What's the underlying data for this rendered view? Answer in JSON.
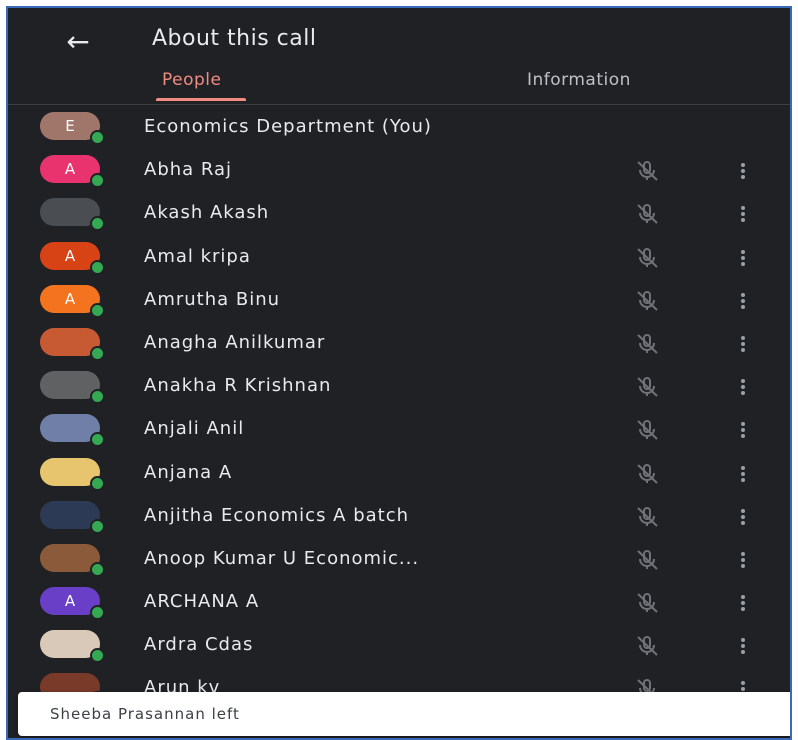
{
  "header": {
    "title": "About this call",
    "tabs": [
      {
        "label": "People",
        "active": true
      },
      {
        "label": "Information",
        "active": false
      }
    ]
  },
  "participants": [
    {
      "name": "Economics Department (You)",
      "avatar_letter": "E",
      "avatar_color": "#a1766a",
      "show_controls": false
    },
    {
      "name": "Abha Raj",
      "avatar_letter": "A",
      "avatar_color": "#e8336f",
      "show_controls": true
    },
    {
      "name": "Akash Akash",
      "avatar_letter": "",
      "avatar_color": "#4a4d52",
      "show_controls": true
    },
    {
      "name": "Amal kripa",
      "avatar_letter": "A",
      "avatar_color": "#d84315",
      "show_controls": true
    },
    {
      "name": "Amrutha Binu",
      "avatar_letter": "A",
      "avatar_color": "#f4731f",
      "show_controls": true
    },
    {
      "name": "Anagha Anilkumar",
      "avatar_letter": "",
      "avatar_color": "#c75a32",
      "show_controls": true
    },
    {
      "name": "Anakha R Krishnan",
      "avatar_letter": "",
      "avatar_color": "#5f6163",
      "show_controls": true
    },
    {
      "name": "Anjali Anil",
      "avatar_letter": "",
      "avatar_color": "#6f7fa8",
      "show_controls": true
    },
    {
      "name": "Anjana A",
      "avatar_letter": "",
      "avatar_color": "#e6c56e",
      "show_controls": true
    },
    {
      "name": "Anjitha Economics A batch",
      "avatar_letter": "",
      "avatar_color": "#2d3a55",
      "show_controls": true
    },
    {
      "name": "Anoop Kumar U Economic...",
      "avatar_letter": "",
      "avatar_color": "#8a5a3a",
      "show_controls": true
    },
    {
      "name": "ARCHANA A",
      "avatar_letter": "A",
      "avatar_color": "#6a3fc8",
      "show_controls": true
    },
    {
      "name": "Ardra Cdas",
      "avatar_letter": "",
      "avatar_color": "#d9c9b9",
      "show_controls": true
    },
    {
      "name": "Arun kv",
      "avatar_letter": "",
      "avatar_color": "#7a3a2a",
      "show_controls": true
    }
  ],
  "toast": {
    "text": "Sheeba Prasannan left"
  },
  "icons": {
    "back": "arrow-left-icon",
    "mic": "mic-off-icon",
    "more": "more-vertical-icon"
  },
  "colors": {
    "background": "#202124",
    "accent": "#f28b82",
    "online": "#34a853"
  }
}
